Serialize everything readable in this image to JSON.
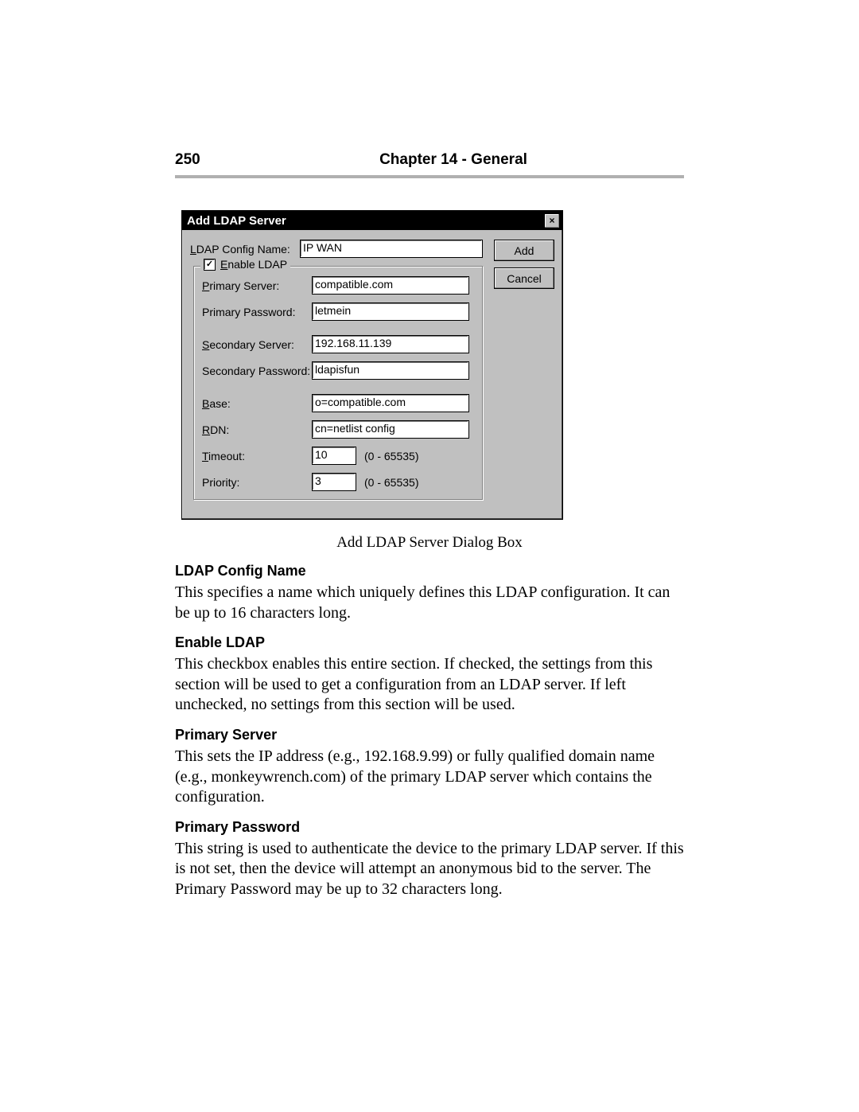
{
  "header": {
    "page": "250",
    "title": "Chapter 14 - General"
  },
  "dialog": {
    "title": "Add LDAP Server",
    "config_name": {
      "label": "LDAP Config Name:",
      "value": "IP WAN",
      "accesskey": "L"
    },
    "enable": {
      "label": "Enable LDAP",
      "checked": true,
      "accesskey": "E"
    },
    "primary_server": {
      "label": "Primary Server:",
      "value": "compatible.com",
      "accesskey": "P"
    },
    "primary_password": {
      "label": "Primary Password:",
      "value": "letmein"
    },
    "secondary_server": {
      "label": "Secondary Server:",
      "value": "192.168.11.139",
      "accesskey": "S"
    },
    "secondary_password": {
      "label": "Secondary Password:",
      "value": "ldapisfun"
    },
    "base": {
      "label": "Base:",
      "value": "o=compatible.com",
      "accesskey": "B"
    },
    "rdn": {
      "label": "RDN:",
      "value": "cn=netlist config",
      "accesskey": "R"
    },
    "timeout": {
      "label": "Timeout:",
      "value": "10",
      "range": "(0 - 65535)",
      "accesskey": "T"
    },
    "priority": {
      "label": "Priority:",
      "value": "3",
      "range": "(0 - 65535)"
    },
    "buttons": {
      "add": "Add",
      "cancel": "Cancel"
    }
  },
  "caption": "Add LDAP Server Dialog Box",
  "sections": [
    {
      "h": "LDAP Config Name",
      "p": "This specifies a name which uniquely defines this LDAP configuration. It can be up to 16 characters long."
    },
    {
      "h": "Enable LDAP",
      "p": "This checkbox enables this entire section. If checked, the settings from this section will be used to get a configuration from an LDAP server. If left unchecked, no settings from this section will be used."
    },
    {
      "h": "Primary Server",
      "p": "This sets the IP address (e.g., 192.168.9.99) or fully qualified domain name (e.g., monkeywrench.com) of the primary LDAP server which contains the configuration."
    },
    {
      "h": "Primary Password",
      "p": "This string is used to authenticate the device to the primary LDAP server. If this is not set, then the device will attempt an anonymous bid to the server. The Primary Password may be up to 32 characters long."
    }
  ]
}
